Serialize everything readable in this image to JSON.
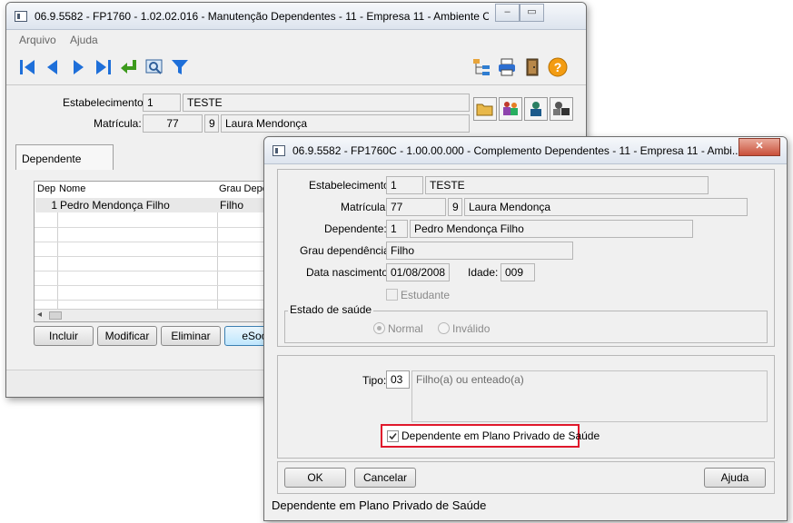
{
  "back_window": {
    "title": "06.9.5582 - FP1760 - 1.02.02.016 - Manutenção Dependentes - 11 - Empresa 11 - Ambiente C...",
    "menu": [
      "Arquivo",
      "Ajuda"
    ],
    "estabelecimento_label": "Estabelecimento:",
    "estabelecimento_code": "1",
    "estabelecimento_name": "TESTE",
    "matricula_label": "Matrícula:",
    "matricula_value": "77",
    "matricula_digit": "9",
    "matricula_name": "Laura Mendonça",
    "tab_label": "Dependente",
    "grid": {
      "columns": [
        "Dep",
        "Nome",
        "Grau Depe"
      ],
      "rows": [
        {
          "dep": "1",
          "nome": "Pedro Mendonça Filho",
          "grau": "Filho"
        }
      ]
    },
    "buttons": [
      "Incluir",
      "Modificar",
      "Eliminar",
      "eSoc"
    ]
  },
  "front_window": {
    "title": "06.9.5582 - FP1760C - 1.00.00.000 - Complemento Dependentes - 11 - Empresa 11 - Ambi...",
    "estabelecimento_label": "Estabelecimento:",
    "estabelecimento_code": "1",
    "estabelecimento_name": "TESTE",
    "matricula_label": "Matrícula:",
    "matricula_value": "77",
    "matricula_digit": "9",
    "matricula_name": "Laura Mendonça",
    "dependente_label": "Dependente:",
    "dependente_code": "1",
    "dependente_name": "Pedro Mendonça Filho",
    "grau_label": "Grau dependência:",
    "grau_value": "Filho",
    "nascimento_label": "Data nascimento:",
    "nascimento_value": "01/08/2008",
    "idade_label": "Idade:",
    "idade_value": "009",
    "estudante_label": "Estudante",
    "estado_saude_label": "Estado de saúde",
    "radio_normal": "Normal",
    "radio_invalido": "Inválido",
    "tipo_label": "Tipo:",
    "tipo_code": "03",
    "tipo_desc": "Filho(a) ou enteado(a)",
    "plano_label": "Dependente em Plano Privado de Saúde",
    "plano_checked": true,
    "ok_label": "OK",
    "cancelar_label": "Cancelar",
    "ajuda_label": "Ajuda",
    "status_text": "Dependente em Plano Privado de Saúde"
  },
  "colors": {
    "highlight": "#e0182b",
    "toolbar_blue": "#1e6fd9",
    "help_orange": "#f39c12"
  }
}
